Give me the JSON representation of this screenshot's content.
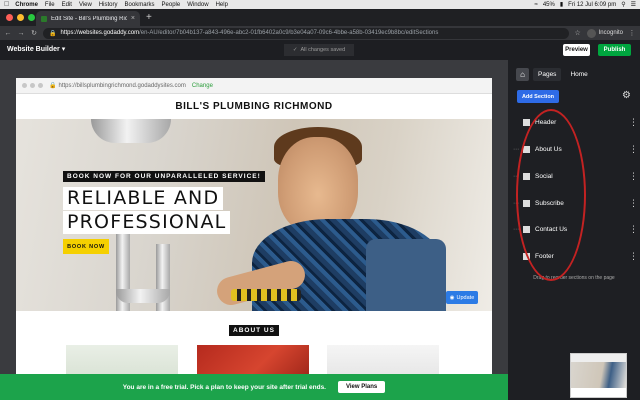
{
  "menubar": {
    "app": "Chrome",
    "items": [
      "File",
      "Edit",
      "View",
      "History",
      "Bookmarks",
      "People",
      "Window",
      "Help"
    ],
    "battery": "45%",
    "datetime": "Fri 12 Jul 6:09 pm"
  },
  "browser": {
    "tab_title": "Edit Site - Bill's Plumbing Richm",
    "url_host": "https://websites.godaddy.com",
    "url_path": "/en-AU/editor/7b04b137-a843-496e-abc2-01fb6402a0c9/b3e04a07-09c6-4bbe-a58b-03419ec9b8bc/editSections",
    "incognito": "Incognito"
  },
  "editor": {
    "brand": "Website Builder",
    "saved_status": "All changes saved",
    "preview_label": "Preview",
    "publish_label": "Publish"
  },
  "site": {
    "frame_url": "https://billsplumbingrichmond.godaddysites.com",
    "change_label": "Change",
    "title": "BILL'S PLUMBING RICHMOND",
    "tagline": "BOOK NOW FOR OUR UNPARALLELED SERVICE!",
    "headline_1": "RELIABLE AND",
    "headline_2": "PROFESSIONAL",
    "cta": "BOOK NOW",
    "update_label": "Update",
    "about_heading": "ABOUT US"
  },
  "trial": {
    "message": "You are in a free trial. Pick a plan to keep your site after trial ends.",
    "button": "View Plans"
  },
  "panel": {
    "tabs": [
      "Pages",
      "Home"
    ],
    "add_section": "Add Section",
    "sections": [
      "Header",
      "About Us",
      "Social",
      "Subscribe",
      "Contact Us",
      "Footer"
    ],
    "hint": "Drag to reorder sections on the page"
  },
  "colors": {
    "publish": "#00a63f",
    "add_section": "#2e6be6",
    "trial_banner": "#1ca34b",
    "cta": "#f5d000",
    "annotation": "#c32222"
  }
}
